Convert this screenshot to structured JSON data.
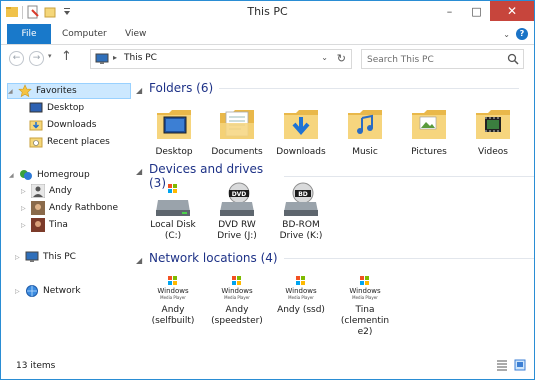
{
  "title": "This PC",
  "ribbon": {
    "tabs": [
      "File",
      "Computer",
      "View"
    ]
  },
  "address": {
    "path": "This PC",
    "search_placeholder": "Search This PC"
  },
  "navpane": {
    "favorites": {
      "label": "Favorites",
      "items": [
        "Desktop",
        "Downloads",
        "Recent places"
      ]
    },
    "homegroup": {
      "label": "Homegroup",
      "items": [
        "Andy",
        "Andy Rathbone",
        "Tina"
      ]
    },
    "thispc": "This PC",
    "network": "Network"
  },
  "groups": {
    "folders": {
      "title": "Folders (6)",
      "items": [
        "Desktop",
        "Documents",
        "Downloads",
        "Music",
        "Pictures",
        "Videos"
      ]
    },
    "devices": {
      "title": "Devices and drives (3)",
      "items": [
        [
          "Local Disk",
          "(C:)"
        ],
        [
          "DVD RW",
          "Drive (J:)"
        ],
        [
          "BD-ROM",
          "Drive (K:)"
        ]
      ],
      "disc_labels": [
        "DVD",
        "BD"
      ]
    },
    "network": {
      "title": "Network locations (4)",
      "items": [
        [
          "Andy",
          "(selfbuilt)"
        ],
        [
          "Andy",
          "(speedster)"
        ],
        [
          "Andy (ssd)"
        ],
        [
          "Tina",
          "(clementin",
          "e2)"
        ]
      ],
      "logo_text": [
        "Windows",
        "Media Player"
      ]
    }
  },
  "status": "13 items",
  "colors": {
    "accent": "#1979ca",
    "group_heading": "#1e3287",
    "close_button": "#c7453c",
    "selection": "#cce8ff"
  },
  "icons": {
    "folder": "folder-icon",
    "drive": "drive-icon",
    "media_player": "windows-media-player-icon"
  }
}
